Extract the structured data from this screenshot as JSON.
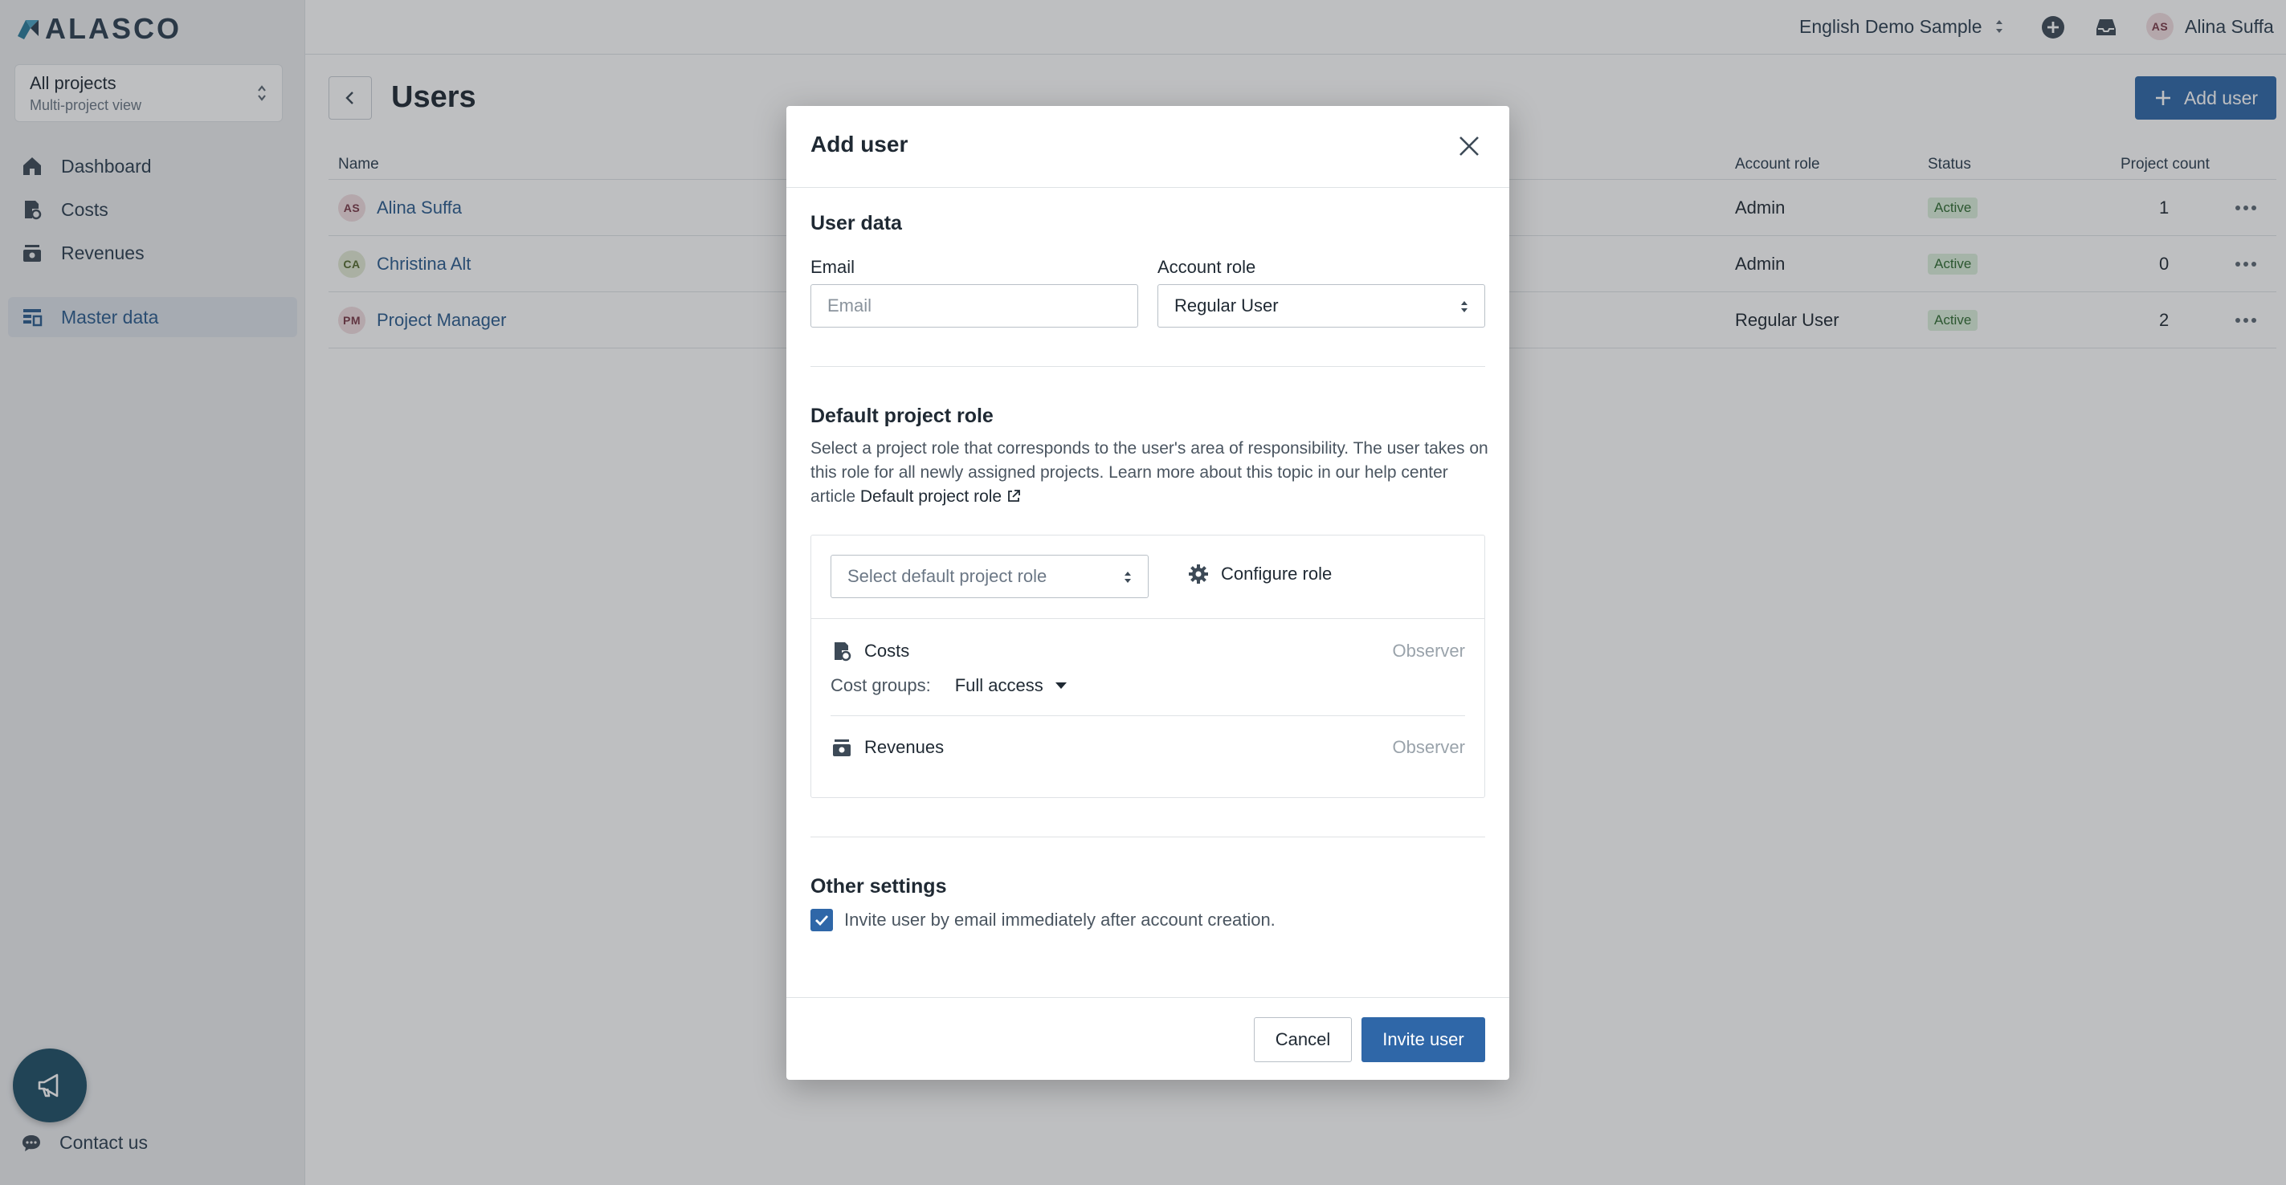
{
  "app": {
    "logo_text": "ALASCO"
  },
  "project_switcher": {
    "title": "All projects",
    "subtitle": "Multi-project view"
  },
  "sidebar": {
    "items": [
      {
        "label": "Dashboard",
        "icon": "home-icon"
      },
      {
        "label": "Costs",
        "icon": "costs-icon"
      },
      {
        "label": "Revenues",
        "icon": "revenues-icon"
      },
      {
        "label": "Master data",
        "icon": "master-data-icon",
        "active": true
      }
    ],
    "contact_label": "Contact us"
  },
  "topbar": {
    "org_name": "English Demo Sample",
    "user_initials": "AS",
    "user_name": "Alina Suffa"
  },
  "page": {
    "title": "Users",
    "add_user_label": "Add user"
  },
  "table": {
    "headers": {
      "name": "Name",
      "account_role": "Account role",
      "status": "Status",
      "project_count": "Project count"
    },
    "rows": [
      {
        "initials": "AS",
        "name": "Alina Suffa",
        "account_role": "Admin",
        "status": "Active",
        "project_count": "1"
      },
      {
        "initials": "CA",
        "name": "Christina Alt",
        "account_role": "Admin",
        "status": "Active",
        "project_count": "0"
      },
      {
        "initials": "PM",
        "name": "Project Manager",
        "account_role": "Regular User",
        "status": "Active",
        "project_count": "2"
      }
    ]
  },
  "modal": {
    "title": "Add user",
    "user_data": {
      "section_title": "User data",
      "email_label": "Email",
      "email_placeholder": "Email",
      "email_value": "",
      "role_label": "Account role",
      "role_value": "Regular User"
    },
    "default_role": {
      "section_title": "Default project role",
      "description": "Select a project role that corresponds to the user's area of responsibility. The user takes on this role for all newly assigned projects. Learn more about this topic in our help center article ",
      "link_label": "Default project role",
      "select_placeholder": "Select default project role",
      "configure_label": "Configure role",
      "modules": [
        {
          "name": "Costs",
          "role": "Observer"
        },
        {
          "name": "Revenues",
          "role": "Observer"
        }
      ],
      "cost_groups_label": "Cost groups:",
      "cost_groups_value": "Full access"
    },
    "other_settings": {
      "section_title": "Other settings",
      "invite_checkbox_label": "Invite user by email immediately after account creation.",
      "invite_checked": true
    },
    "cancel_label": "Cancel",
    "invite_label": "Invite user"
  },
  "colors": {
    "primary": "#2f67a8",
    "link": "#2b5c8f",
    "fab": "#1f4f66",
    "status_bg": "#dcefdc"
  }
}
